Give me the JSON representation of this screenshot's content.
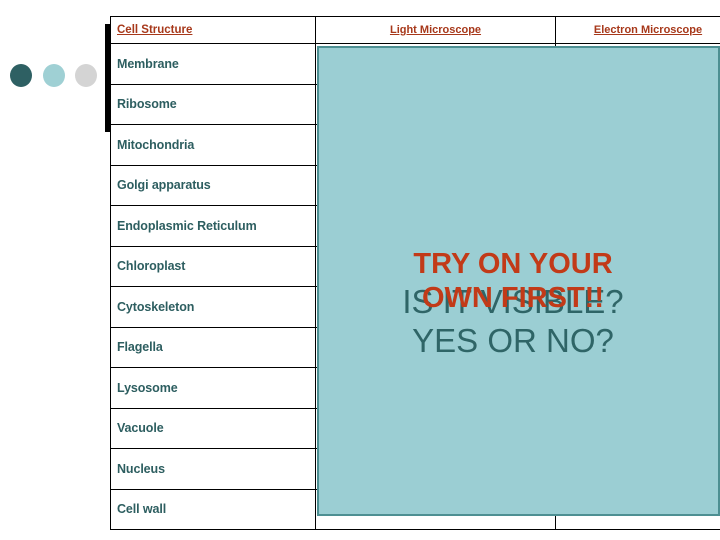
{
  "slide": {
    "decor_dots": [
      {
        "name": "dot-dark-teal",
        "color": "#2e6063"
      },
      {
        "name": "dot-light-teal",
        "color": "#9fd0d4"
      },
      {
        "name": "dot-gray",
        "color": "#d4d4d4"
      }
    ]
  },
  "table": {
    "headers": [
      "Cell Structure",
      "Light Microscope",
      "Electron Microscope"
    ],
    "rows": [
      {
        "structure": "Membrane",
        "light": "",
        "electron": ""
      },
      {
        "structure": "Ribosome",
        "light": "",
        "electron": ""
      },
      {
        "structure": "Mitochondria",
        "light": "",
        "electron": ""
      },
      {
        "structure": "Golgi apparatus",
        "light": "",
        "electron": ""
      },
      {
        "structure": "Endoplasmic Reticulum",
        "light": "",
        "electron": ""
      },
      {
        "structure": "Chloroplast",
        "light": "",
        "electron": ""
      },
      {
        "structure": "Cytoskeleton",
        "light": "",
        "electron": ""
      },
      {
        "structure": "Flagella",
        "light": "",
        "electron": ""
      },
      {
        "structure": "Lysosome",
        "light": "",
        "electron": ""
      },
      {
        "structure": "Vacuole",
        "light": "",
        "electron": ""
      },
      {
        "structure": "Nucleus",
        "light": "",
        "electron": ""
      },
      {
        "structure": "Cell wall",
        "light": "",
        "electron": ""
      }
    ]
  },
  "cover": {
    "fill_color": "#9bced3",
    "border_color": "#4d8f92"
  },
  "overlay": {
    "prompt_red": "TRY ON YOUR OWN FIRST!!",
    "prompt_red_color": "#c23a18",
    "question_teal": "IS IT VISIBLE? YES OR NO?",
    "question_teal_color": "#2f6567"
  }
}
